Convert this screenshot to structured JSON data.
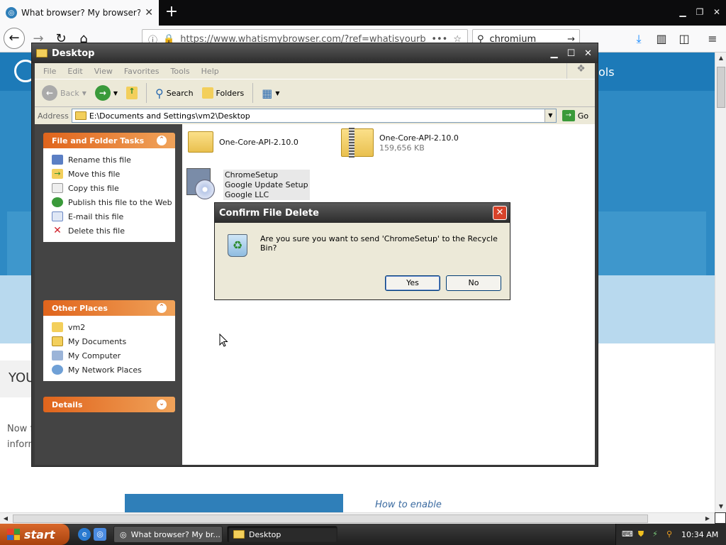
{
  "browser": {
    "tab_title": "What browser? My browser? Is my",
    "tab_close": "✕",
    "new_tab": "+",
    "url": "https://www.whatismybrowser.com/?ref=whatisyourb",
    "url_more": "•••",
    "search_value": "chromium",
    "page": {
      "header_tools": "ols",
      "you_label": "YOU",
      "now_line1": "Now f",
      "now_line2": "inform",
      "how_to": "How to enable"
    }
  },
  "explorer": {
    "title": "Desktop",
    "menu": [
      "File",
      "Edit",
      "View",
      "Favorites",
      "Tools",
      "Help"
    ],
    "toolbar": {
      "back": "Back",
      "search": "Search",
      "folders": "Folders"
    },
    "address_label": "Address",
    "address_value": "E:\\Documents and Settings\\vm2\\Desktop",
    "go_label": "Go",
    "file_tasks": {
      "title": "File and Folder Tasks",
      "items": [
        "Rename this file",
        "Move this file",
        "Copy this file",
        "Publish this file to the Web",
        "E-mail this file",
        "Delete this file"
      ]
    },
    "other_places": {
      "title": "Other Places",
      "items": [
        "vm2",
        "My Documents",
        "My Computer",
        "My Network Places"
      ]
    },
    "details": {
      "title": "Details"
    },
    "files": [
      {
        "name": "One-Core-API-2.10.0",
        "detail": "",
        "company": ""
      },
      {
        "name": "One-Core-API-2.10.0",
        "detail": "159,656 KB",
        "company": ""
      },
      {
        "name": "ChromeSetup",
        "detail": "Google Update Setup",
        "company": "Google LLC"
      }
    ]
  },
  "dialog": {
    "title": "Confirm File Delete",
    "message": "Are you sure you want to send 'ChromeSetup' to the Recycle Bin?",
    "yes": "Yes",
    "no": "No"
  },
  "taskbar": {
    "start": "start",
    "tasks": [
      "What browser? My br...",
      "Desktop"
    ],
    "clock": "10:34 AM"
  },
  "colors": {
    "site_blue": "#2e8ac4",
    "xp_orange": "#e0641c",
    "dialog_bg": "#ece9d8"
  }
}
